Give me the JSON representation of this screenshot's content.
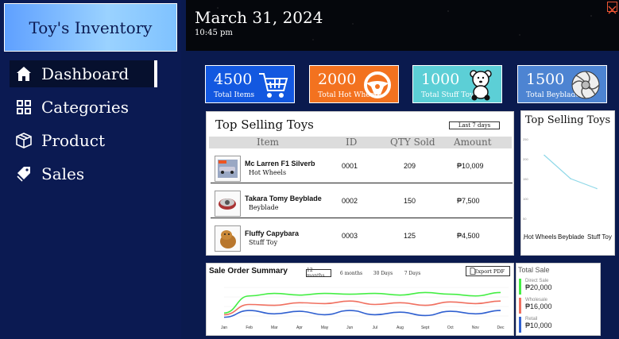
{
  "app": {
    "title": "Toy's Inventory"
  },
  "nav": {
    "dashboard": "Dashboard",
    "categories": "Categories",
    "product": "Product",
    "sales": "Sales"
  },
  "header": {
    "date": "March 31, 2024",
    "time": "10:45 pm"
  },
  "cards": {
    "items": {
      "value": "4500",
      "label": "Total Items",
      "icon": "cart-icon"
    },
    "hot": {
      "value": "2000",
      "label": "Total Hot Wheels",
      "icon": "steering-wheel-icon"
    },
    "stuff": {
      "value": "1000",
      "label": "Total Stuff Toy",
      "icon": "teddy-bear-icon"
    },
    "bey": {
      "value": "1500",
      "label": "Total Beyblade",
      "icon": "beyblade-icon"
    }
  },
  "top_table": {
    "title": "Top Selling Toys",
    "range": "Last 7 days",
    "headers": [
      "Item",
      "ID",
      "QTY Sold",
      "Amount"
    ],
    "rows": [
      {
        "name": "Mc Larren F1 Silverb",
        "category": "Hot Wheels",
        "id": "0001",
        "qty": "209",
        "amount": "₱10,009"
      },
      {
        "name": "Takara Tomy Beyblade",
        "category": "Beyblade",
        "id": "0002",
        "qty": "150",
        "amount": "₱7,500"
      },
      {
        "name": "Fluffy Capybara",
        "category": "Stuff Toy",
        "id": "0003",
        "qty": "125",
        "amount": "₱4,500"
      }
    ]
  },
  "chart_data": [
    {
      "type": "line",
      "title": "Top Selling Toys",
      "categories": [
        "Hot Wheels",
        "Beyblade",
        "Stuff Toy"
      ],
      "values": [
        209,
        150,
        125
      ],
      "yticks": [
        0,
        50,
        100,
        150,
        200,
        250
      ],
      "ylim": [
        0,
        250
      ],
      "color": "#8fd8e8"
    },
    {
      "type": "line",
      "title": "Sale Order Summary",
      "categories": [
        "Jan",
        "Feb",
        "Mar",
        "Apr",
        "May",
        "Jun",
        "Jul",
        "Aug",
        "Sept",
        "Oct",
        "Nov",
        "Dec"
      ],
      "ranges": [
        "12 months",
        "6 months",
        "30 Days",
        "7 Days"
      ],
      "export_label": "Export PDF",
      "series": [
        {
          "name": "Direct Sale",
          "color": "#44ee44",
          "values": [
            10,
            30,
            33,
            31,
            33,
            32,
            33,
            31,
            34,
            32,
            30,
            34
          ]
        },
        {
          "name": "Wholesale",
          "color": "#f07060",
          "values": [
            8,
            20,
            19,
            22,
            21,
            24,
            20,
            22,
            19,
            23,
            21,
            24
          ]
        },
        {
          "name": "Retail",
          "color": "#3060d0",
          "values": [
            5,
            13,
            9,
            12,
            8,
            13,
            8,
            11,
            7,
            12,
            9,
            13
          ]
        }
      ],
      "ylim": [
        0,
        40
      ]
    }
  ],
  "total_sale": {
    "title": "Total Sale",
    "items": [
      {
        "label": "Direct Sale",
        "value": "₱20,000",
        "color": "#44ee44"
      },
      {
        "label": "Wholesale",
        "value": "₱16,000",
        "color": "#f07060"
      },
      {
        "label": "Retail",
        "value": "₱10,000",
        "color": "#3060d0"
      }
    ]
  }
}
